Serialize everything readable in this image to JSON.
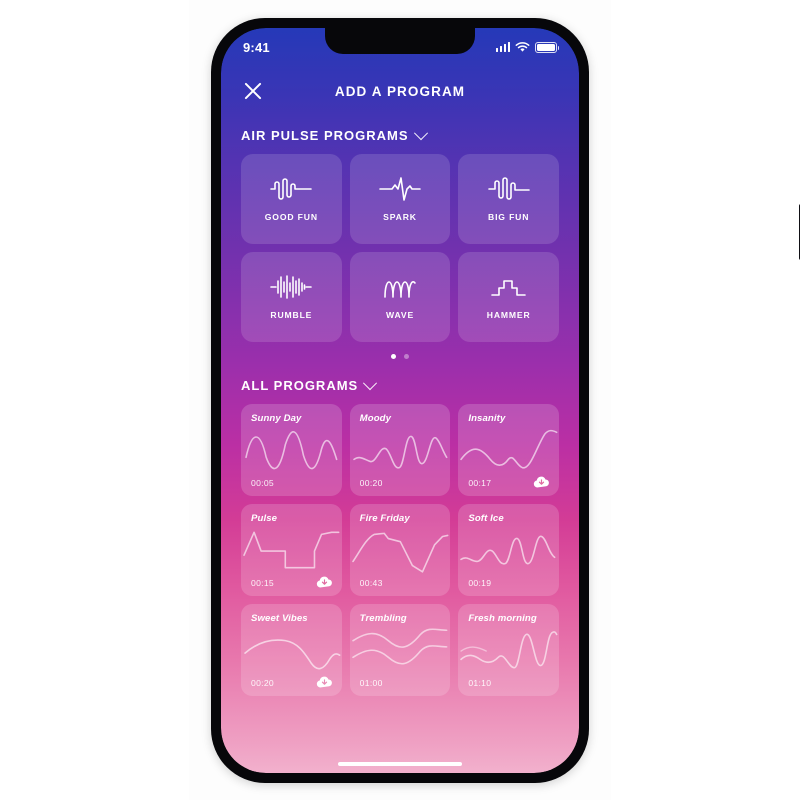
{
  "statusbar": {
    "time": "9:41",
    "signal_icon": "signal-bars-icon",
    "wifi_icon": "wifi-icon",
    "battery_icon": "battery-icon"
  },
  "navbar": {
    "title": "ADD A PROGRAM",
    "close_icon": "close-icon"
  },
  "sections": {
    "air_pulse": {
      "title": "AIR PULSE PROGRAMS",
      "chevron_icon": "chevron-down-icon"
    },
    "all_programs": {
      "title": "ALL PROGRAMS",
      "chevron_icon": "chevron-down-icon"
    }
  },
  "air_pulse_tiles": [
    {
      "label": "GOOD FUN",
      "icon": "waveform-good-fun-icon"
    },
    {
      "label": "SPARK",
      "icon": "waveform-spark-icon"
    },
    {
      "label": "BIG FUN",
      "icon": "waveform-big-fun-icon"
    },
    {
      "label": "RUMBLE",
      "icon": "waveform-rumble-icon"
    },
    {
      "label": "WAVE",
      "icon": "waveform-wave-icon"
    },
    {
      "label": "HAMMER",
      "icon": "waveform-hammer-icon"
    }
  ],
  "pagination": {
    "total": 2,
    "active_index": 0
  },
  "programs": [
    {
      "name": "Sunny Day",
      "duration": "00:05",
      "cloud": false
    },
    {
      "name": "Moody",
      "duration": "00:20",
      "cloud": false
    },
    {
      "name": "Insanity",
      "duration": "00:17",
      "cloud": true
    },
    {
      "name": "Pulse",
      "duration": "00:15",
      "cloud": true
    },
    {
      "name": "Fire Friday",
      "duration": "00:43",
      "cloud": false
    },
    {
      "name": "Soft Ice",
      "duration": "00:19",
      "cloud": false
    },
    {
      "name": "Sweet Vibes",
      "duration": "00:20",
      "cloud": true
    },
    {
      "name": "Trembling",
      "duration": "01:00",
      "cloud": false
    },
    {
      "name": "Fresh morning",
      "duration": "01:10",
      "cloud": false
    }
  ],
  "colors": {
    "gradient_top": "#2539b8",
    "gradient_mid": "#a32fac",
    "gradient_bottom": "#f2b1cd",
    "tile_surface": "rgba(255,255,255,0.14)",
    "text_primary": "#ffffff"
  }
}
